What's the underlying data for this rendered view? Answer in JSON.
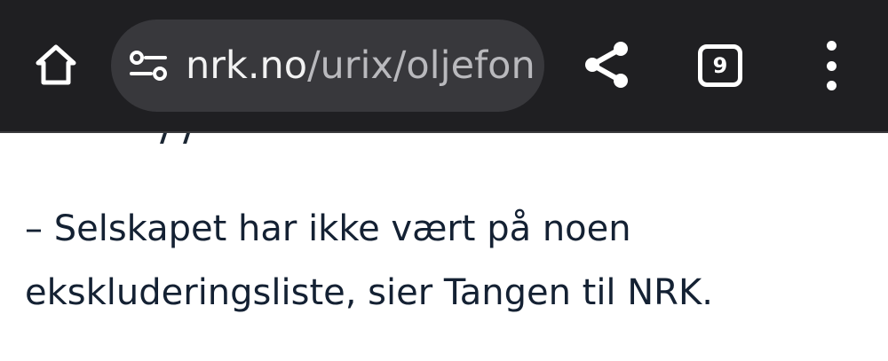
{
  "browser": {
    "url_host": "nrk.no",
    "url_path": "/urix/oljefon",
    "tab_count": "9",
    "icons": {
      "home": "home-icon",
      "site_settings": "tune-icon",
      "share": "share-icon",
      "tabs": "tab-switcher-icon",
      "menu": "more-vert-icon"
    },
    "colors": {
      "toolbar_bg": "#1f1f22",
      "omnibox_bg": "#38383c",
      "url_host": "#f2f2f2",
      "url_path": "#b9b9bd"
    }
  },
  "article": {
    "paragraph": "– Selskapet har ikke vært på noen ekskluderingsliste, sier Tangen til NRK.",
    "text_color": "#142133"
  }
}
